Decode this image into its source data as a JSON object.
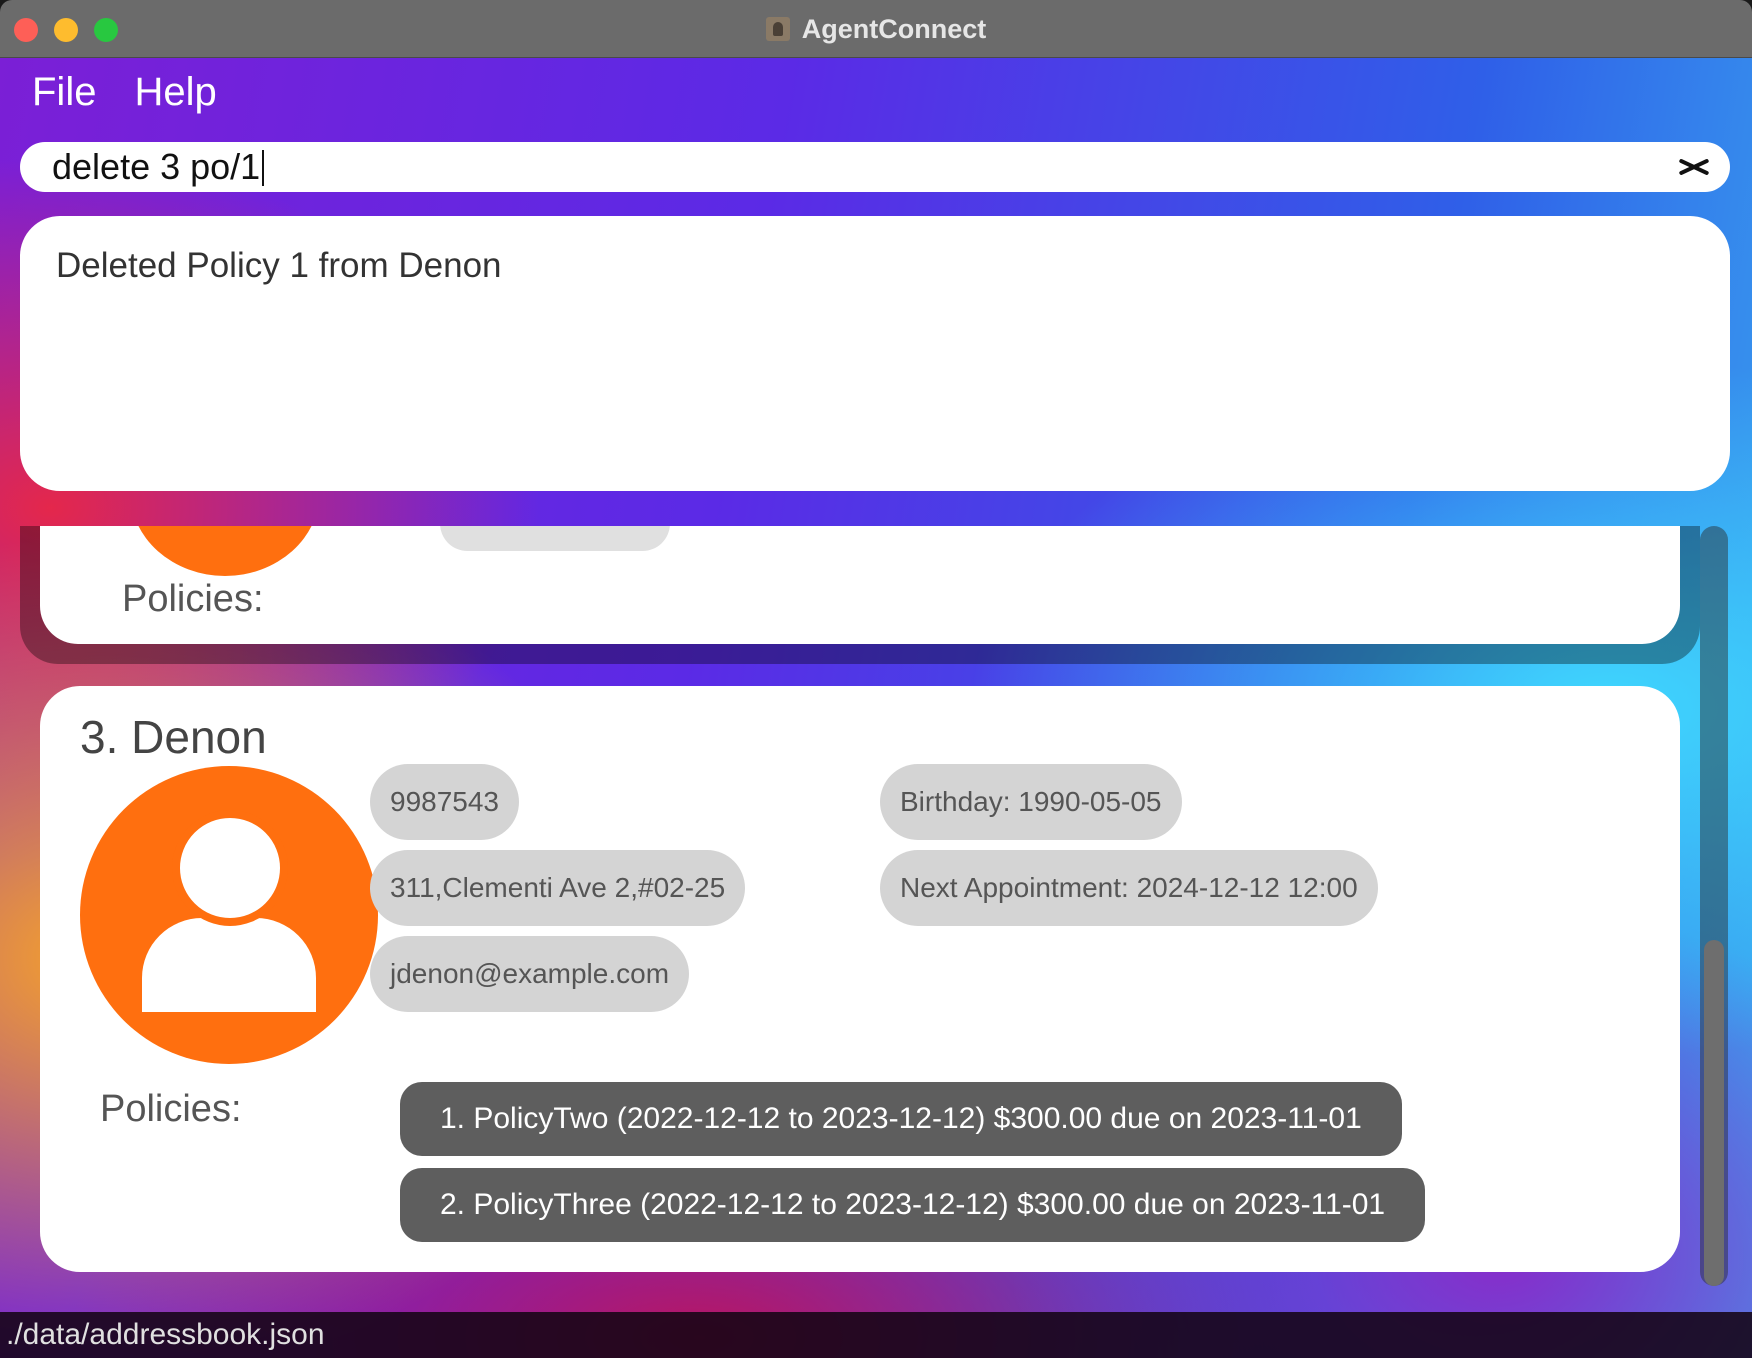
{
  "window": {
    "title": "AgentConnect"
  },
  "menu": {
    "file": "File",
    "help": "Help"
  },
  "command": {
    "value": "delete 3 po/1"
  },
  "result": {
    "message": "Deleted Policy 1 from Denon"
  },
  "previous_card": {
    "policies_label": "Policies:"
  },
  "person": {
    "name": "3. Denon",
    "phone": "9987543",
    "address": "311,Clementi Ave 2,#02-25",
    "email": "jdenon@example.com",
    "birthday": "Birthday: 1990-05-05",
    "next_appointment": "Next Appointment: 2024-12-12 12:00",
    "policies_label": "Policies:",
    "policies": [
      "1. PolicyTwo (2022-12-12 to 2023-12-12) $300.00 due on 2023-11-01",
      "2. PolicyThree (2022-12-12 to 2023-12-12) $300.00 due on 2023-11-01"
    ]
  },
  "status": {
    "path": "./data/addressbook.json"
  },
  "colors": {
    "avatar": "#ff6f0f",
    "policy_tag": "#5e5e5e",
    "field_tag": "#d4d4d4"
  }
}
